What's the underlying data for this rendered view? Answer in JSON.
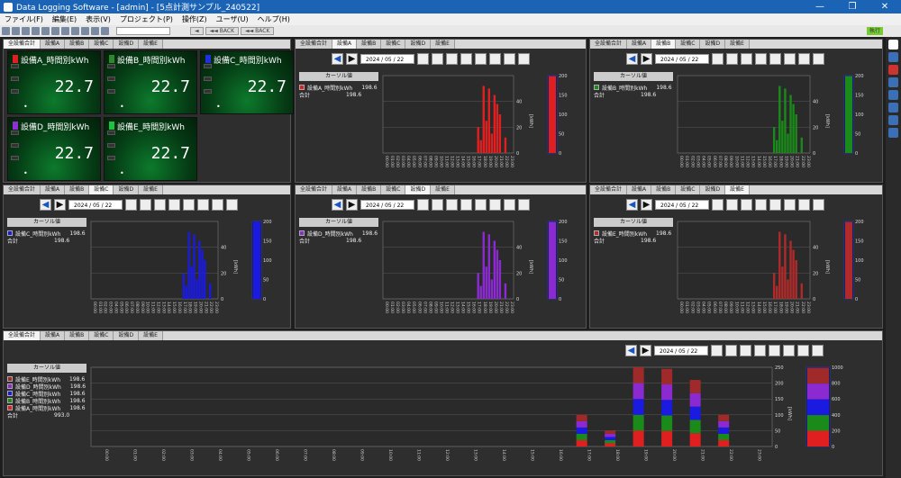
{
  "window": {
    "title": "Data Logging Software - [admin] - [5点計測サンプル_240522]"
  },
  "menu": [
    "ファイル(F)",
    "編集(E)",
    "表示(V)",
    "プロジェクト(P)",
    "操作(Z)",
    "ユーザ(U)",
    "ヘルプ(H)"
  ],
  "toolbar": {
    "btn1": "◄",
    "btn2": "◄◄ BACK",
    "btn3": "◄◄ BACK",
    "right_label": "執行"
  },
  "tabs": [
    "全設備合計",
    "設備A",
    "設備B",
    "設備C",
    "設備D",
    "設備E"
  ],
  "date": "2024 / 05 / 22",
  "cursor_label": "カーソル値",
  "total_label": "合計",
  "cards": [
    {
      "name": "設備A_時間別kWh",
      "value": "22.7",
      "color": "#e02020"
    },
    {
      "name": "設備B_時間別kWh",
      "value": "22.7",
      "color": "#2a8a2a"
    },
    {
      "name": "設備C_時間別kWh",
      "value": "22.7",
      "color": "#2030e0"
    },
    {
      "name": "設備D_時間別kWh",
      "value": "22.7",
      "color": "#9030d0"
    },
    {
      "name": "設備E_時間別kWh",
      "value": "22.7",
      "color": "#20c040"
    }
  ],
  "hours": [
    "00:00",
    "01:00",
    "02:00",
    "03:00",
    "04:00",
    "05:00",
    "06:00",
    "07:00",
    "08:00",
    "09:00",
    "10:00",
    "11:00",
    "12:00",
    "13:00",
    "14:00",
    "15:00",
    "16:00",
    "17:00",
    "18:00",
    "19:00",
    "20:00",
    "21:00",
    "22:00",
    "23:00"
  ],
  "unit_label": "[kWh]",
  "chart_data": [
    {
      "type": "bar",
      "panel": "設備A",
      "series": [
        {
          "name": "設備A_時間別kWh",
          "value_label": "198.6",
          "color": "#e02020",
          "values": [
            {
              "x": "17:00",
              "y": 20
            },
            {
              "x": "17:30",
              "y": 10
            },
            {
              "x": "18:00",
              "y": 52
            },
            {
              "x": "18:30",
              "y": 25
            },
            {
              "x": "19:00",
              "y": 50
            },
            {
              "x": "19:30",
              "y": 15
            },
            {
              "x": "20:00",
              "y": 45
            },
            {
              "x": "20:30",
              "y": 38
            },
            {
              "x": "21:00",
              "y": 30
            },
            {
              "x": "22:00",
              "y": 12
            }
          ]
        }
      ],
      "total": "198.6",
      "ylim": [
        0,
        60
      ],
      "bar_total": 198.6,
      "bar_lim": [
        0,
        200
      ]
    },
    {
      "type": "bar",
      "panel": "設備B",
      "series": [
        {
          "name": "設備B_時間別kWh",
          "value_label": "198.6",
          "color": "#1a8a1a",
          "values": [
            {
              "x": "17:00",
              "y": 20
            },
            {
              "x": "17:30",
              "y": 10
            },
            {
              "x": "18:00",
              "y": 52
            },
            {
              "x": "18:30",
              "y": 25
            },
            {
              "x": "19:00",
              "y": 50
            },
            {
              "x": "19:30",
              "y": 15
            },
            {
              "x": "20:00",
              "y": 45
            },
            {
              "x": "20:30",
              "y": 38
            },
            {
              "x": "21:00",
              "y": 30
            },
            {
              "x": "22:00",
              "y": 12
            }
          ]
        }
      ],
      "total": "198.6",
      "ylim": [
        0,
        60
      ],
      "bar_total": 198.6,
      "bar_lim": [
        0,
        200
      ]
    },
    {
      "type": "bar",
      "panel": "設備C",
      "series": [
        {
          "name": "設備C_時間別kWh",
          "value_label": "198.6",
          "color": "#1a1ae0",
          "values": [
            {
              "x": "17:00",
              "y": 20
            },
            {
              "x": "17:30",
              "y": 10
            },
            {
              "x": "18:00",
              "y": 52
            },
            {
              "x": "18:30",
              "y": 25
            },
            {
              "x": "19:00",
              "y": 50
            },
            {
              "x": "19:30",
              "y": 15
            },
            {
              "x": "20:00",
              "y": 45
            },
            {
              "x": "20:30",
              "y": 38
            },
            {
              "x": "21:00",
              "y": 30
            },
            {
              "x": "22:00",
              "y": 12
            }
          ]
        }
      ],
      "total": "198.6",
      "ylim": [
        0,
        60
      ],
      "bar_total": 198.6,
      "bar_lim": [
        0,
        200
      ]
    },
    {
      "type": "bar",
      "panel": "設備D",
      "series": [
        {
          "name": "設備D_時間別kWh",
          "value_label": "198.6",
          "color": "#8a2ad0",
          "values": [
            {
              "x": "17:00",
              "y": 20
            },
            {
              "x": "17:30",
              "y": 10
            },
            {
              "x": "18:00",
              "y": 52
            },
            {
              "x": "18:30",
              "y": 25
            },
            {
              "x": "19:00",
              "y": 50
            },
            {
              "x": "19:30",
              "y": 15
            },
            {
              "x": "20:00",
              "y": 45
            },
            {
              "x": "20:30",
              "y": 38
            },
            {
              "x": "21:00",
              "y": 30
            },
            {
              "x": "22:00",
              "y": 12
            }
          ]
        }
      ],
      "total": "198.6",
      "ylim": [
        0,
        60
      ],
      "bar_total": 198.6,
      "bar_lim": [
        0,
        200
      ]
    },
    {
      "type": "bar",
      "panel": "設備E",
      "series": [
        {
          "name": "設備E_時間別kWh",
          "value_label": "198.6",
          "color": "#b02a2a",
          "values": [
            {
              "x": "17:00",
              "y": 20
            },
            {
              "x": "17:30",
              "y": 10
            },
            {
              "x": "18:00",
              "y": 52
            },
            {
              "x": "18:30",
              "y": 25
            },
            {
              "x": "19:00",
              "y": 50
            },
            {
              "x": "19:30",
              "y": 15
            },
            {
              "x": "20:00",
              "y": 45
            },
            {
              "x": "20:30",
              "y": 38
            },
            {
              "x": "21:00",
              "y": 30
            },
            {
              "x": "22:00",
              "y": 12
            }
          ]
        }
      ],
      "total": "198.6",
      "ylim": [
        0,
        60
      ],
      "bar_total": 198.6,
      "bar_lim": [
        0,
        200
      ]
    },
    {
      "type": "bar",
      "panel": "全設備合計",
      "stacked": true,
      "series": [
        {
          "name": "設備E_時間別kWh",
          "value_label": "198.6",
          "color": "#a02a2a"
        },
        {
          "name": "設備D_時間別kWh",
          "value_label": "198.6",
          "color": "#8a2ad0"
        },
        {
          "name": "設備C_時間別kWh",
          "value_label": "198.6",
          "color": "#1a1ae0"
        },
        {
          "name": "設備B_時間別kWh",
          "value_label": "198.6",
          "color": "#1a8a1a"
        },
        {
          "name": "設備A_時間別kWh",
          "value_label": "198.6",
          "color": "#e02020"
        }
      ],
      "stack_values": [
        {
          "x": "17:00",
          "y": 100
        },
        {
          "x": "18:00",
          "y": 50
        },
        {
          "x": "19:00",
          "y": 250
        },
        {
          "x": "20:00",
          "y": 245
        },
        {
          "x": "21:00",
          "y": 210
        },
        {
          "x": "22:00",
          "y": 100
        }
      ],
      "total": "993.0",
      "ylim": [
        0,
        250
      ],
      "bar_total": 993,
      "bar_lim": [
        0,
        1000
      ]
    }
  ]
}
